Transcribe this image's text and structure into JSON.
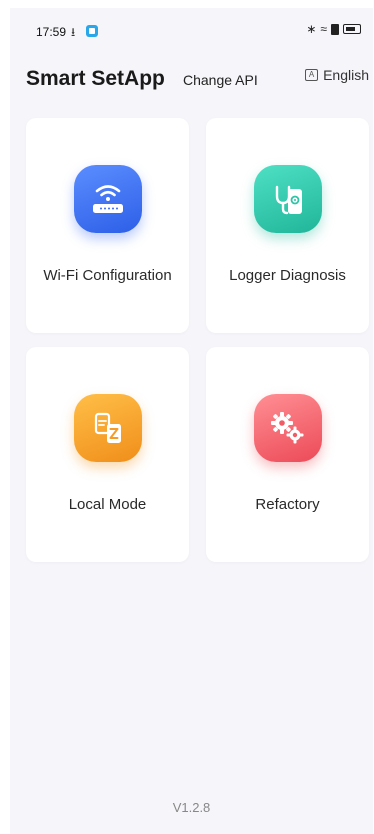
{
  "status_bar": {
    "time": "17:59",
    "download_glyph": "⭳",
    "bluetooth_glyph": "∗",
    "wifi_glyph": "≈"
  },
  "header": {
    "title": "Smart SetApp",
    "change_api": "Change API",
    "language": "English",
    "language_icon_glyph": "A"
  },
  "cards": [
    {
      "label": "Wi-Fi Configuration",
      "icon": "wifi-router-icon",
      "color": "#3a6cf0"
    },
    {
      "label": "Logger Diagnosis",
      "icon": "stethoscope-phone-icon",
      "color": "#2ec4a6"
    },
    {
      "label": "Local Mode",
      "icon": "local-mode-icon",
      "color": "#f59b26"
    },
    {
      "label": "Refactory",
      "icon": "gears-icon",
      "color": "#f05b66"
    }
  ],
  "footer": {
    "version": "V1.2.8"
  }
}
